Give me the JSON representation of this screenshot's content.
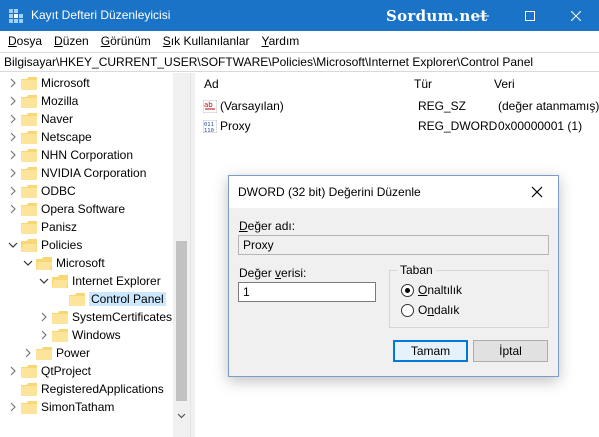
{
  "window": {
    "title": "Kayıt Defteri Düzenleyicisi",
    "watermark": "Sordum.net"
  },
  "menu": [
    {
      "label": "Dosya"
    },
    {
      "label": "Düzen"
    },
    {
      "label": "Görünüm"
    },
    {
      "label": "Sık Kullanılanlar"
    },
    {
      "label": "Yardım"
    }
  ],
  "address": "Bilgisayar\\HKEY_CURRENT_USER\\SOFTWARE\\Policies\\Microsoft\\Internet Explorer\\Control Panel",
  "tree": {
    "items": [
      {
        "label": "Microsoft"
      },
      {
        "label": "Mozilla"
      },
      {
        "label": "Naver"
      },
      {
        "label": "Netscape"
      },
      {
        "label": "NHN Corporation"
      },
      {
        "label": "NVIDIA Corporation"
      },
      {
        "label": "ODBC"
      },
      {
        "label": "Opera Software"
      },
      {
        "label": "Panisz"
      },
      {
        "label": "Policies"
      },
      {
        "label": "Microsoft"
      },
      {
        "label": "Internet Explorer"
      },
      {
        "label": "Control Panel"
      },
      {
        "label": "SystemCertificates"
      },
      {
        "label": "Windows"
      },
      {
        "label": "Power"
      },
      {
        "label": "QtProject"
      },
      {
        "label": "RegisteredApplications"
      },
      {
        "label": "SimonTatham"
      }
    ]
  },
  "list": {
    "columns": {
      "name": "Ad",
      "type": "Tür",
      "data": "Veri"
    },
    "rows": [
      {
        "name": "(Varsayılan)",
        "type": "REG_SZ",
        "data": "(değer atanmamış)",
        "icon": "string-value-icon"
      },
      {
        "name": "Proxy",
        "type": "REG_DWORD",
        "data": "0x00000001 (1)",
        "icon": "binary-value-icon"
      }
    ]
  },
  "dialog": {
    "title": "DWORD (32 bit) Değerini Düzenle",
    "name_label": "Değer adı:",
    "name_value": "Proxy",
    "data_label": "Değer verisi:",
    "data_value": "1",
    "base_label": "Taban",
    "radio_hex": "Onaltılık",
    "radio_dec": "Ondalık",
    "selected_base": "hex",
    "ok": "Tamam",
    "cancel": "İptal"
  },
  "colors": {
    "titlebar": "#1a73c7",
    "folder": "#f8d775",
    "selection": "#cce8ff",
    "accent": "#0078d7"
  }
}
